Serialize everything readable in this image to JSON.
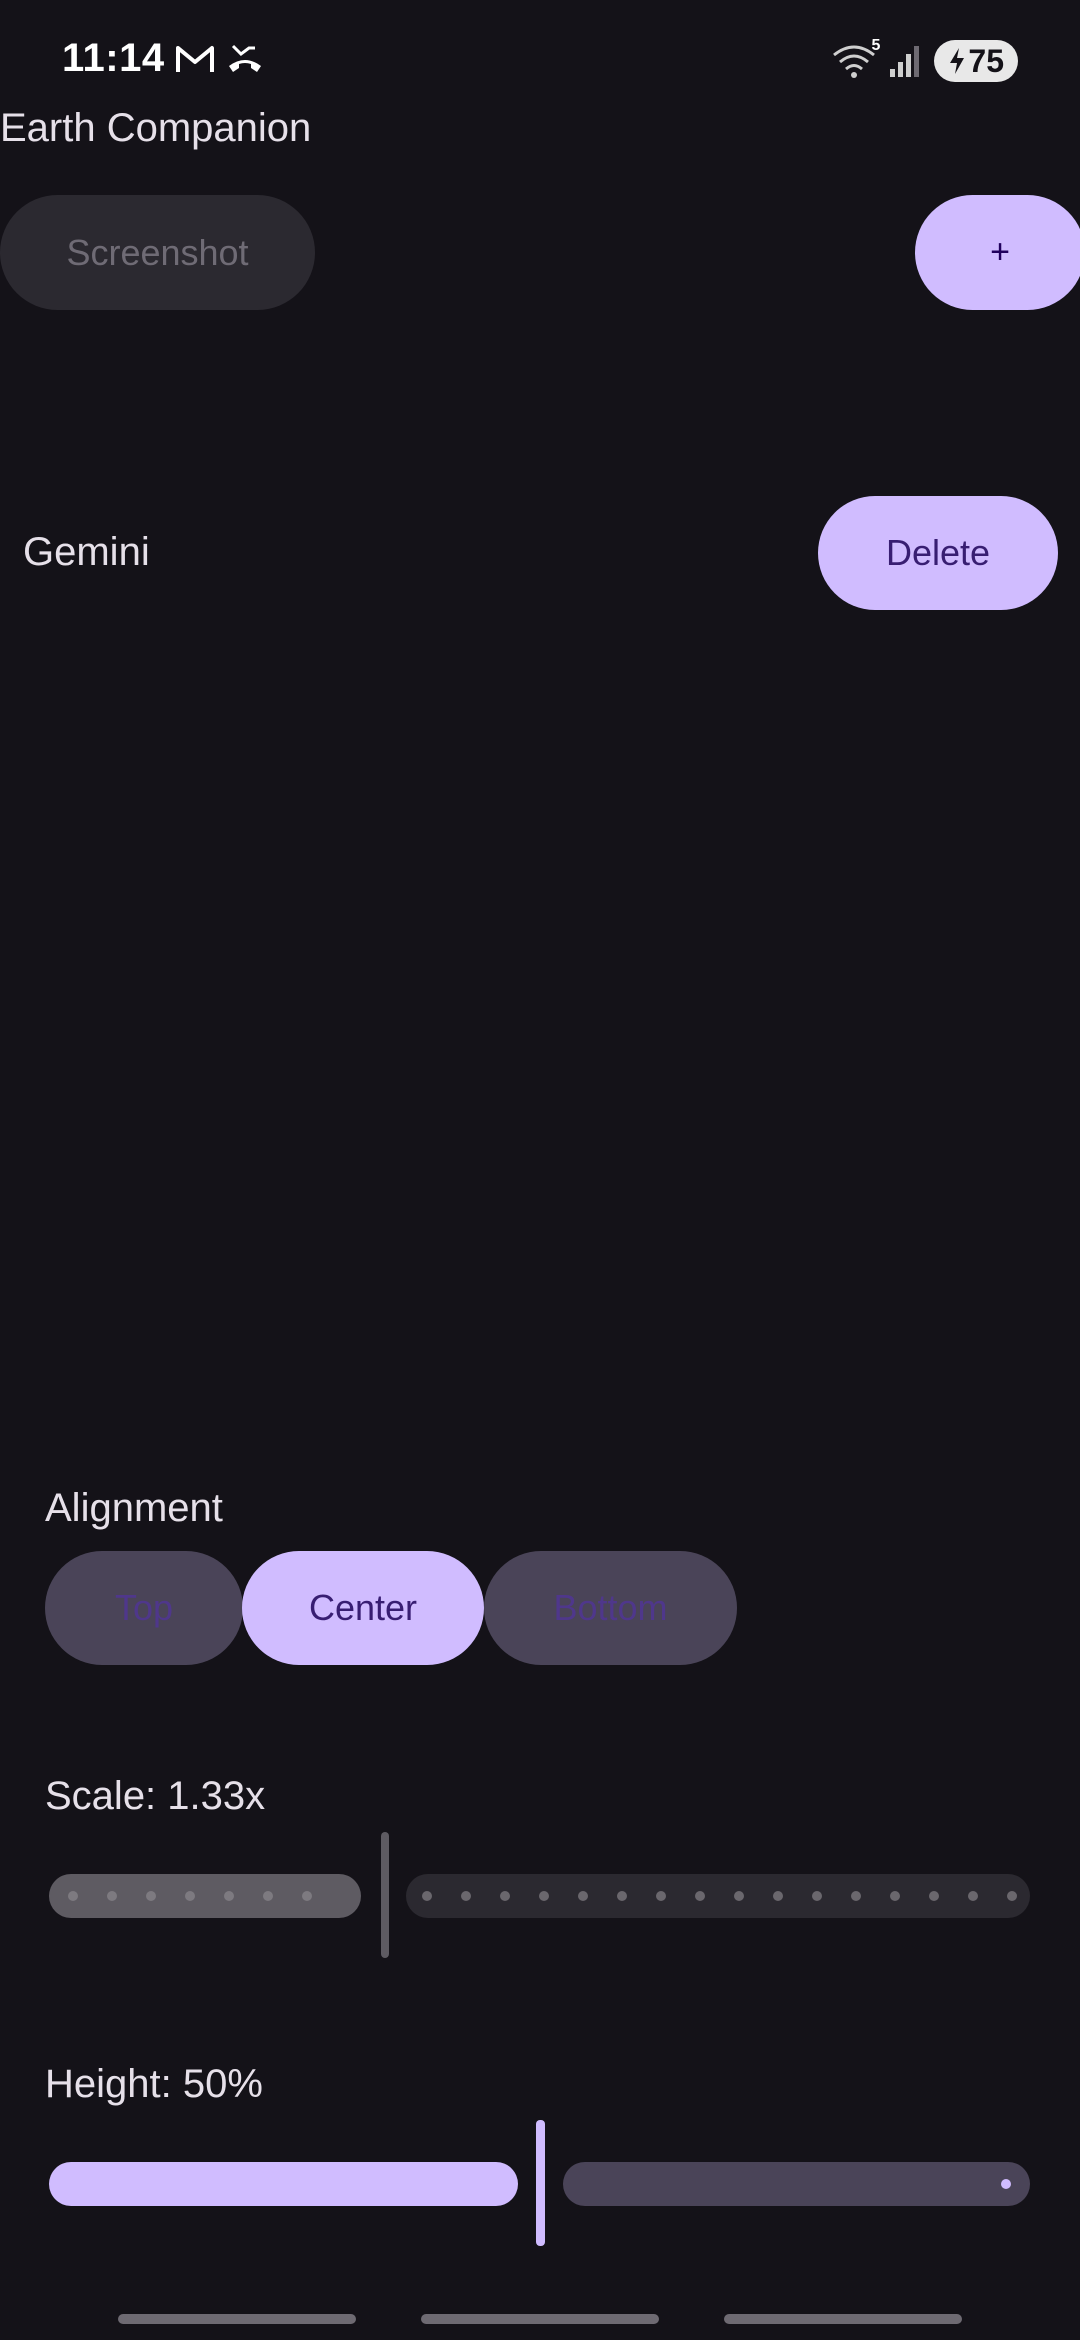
{
  "status_bar": {
    "time": "11:14",
    "battery": "75",
    "wifi_badge": "5",
    "icons_left": [
      "gmail-icon",
      "missed-call-icon"
    ],
    "icons_right": [
      "wifi-icon",
      "signal-icon",
      "battery-icon"
    ]
  },
  "app": {
    "title": "Earth Companion"
  },
  "toolbar": {
    "screenshot_label": "Screenshot",
    "add_label": "+"
  },
  "item": {
    "name": "Gemini",
    "delete_label": "Delete"
  },
  "alignment": {
    "label": "Alignment",
    "options": [
      "Top",
      "Center",
      "Bottom"
    ],
    "selected": "Center"
  },
  "scale": {
    "label": "Scale: 1.33x",
    "value_fraction": 0.33,
    "enabled": false
  },
  "height": {
    "label": "Height: 50%",
    "value_fraction": 0.5,
    "enabled": true
  },
  "colors": {
    "background": "#141218",
    "accent": "#d0bcff",
    "on_accent": "#381e72",
    "surface_variant": "#4a4458",
    "disabled_surface": "#2b2930"
  }
}
